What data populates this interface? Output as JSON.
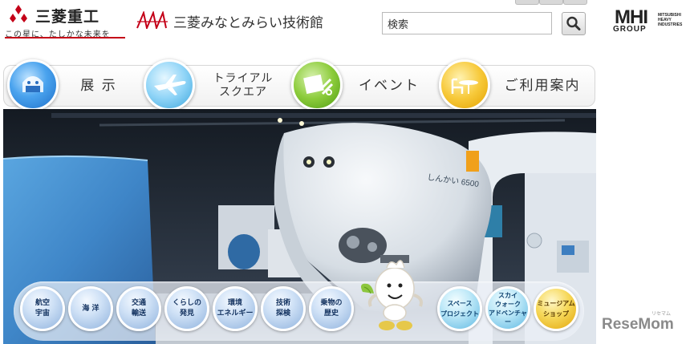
{
  "header": {
    "brand_name": "三菱重工",
    "brand_tagline": "この星に、たしかな未来を",
    "museum_name": "三菱みなとみらい技術館",
    "search": {
      "value": "検索"
    },
    "mhi_logo": {
      "letters": "MHI",
      "group": "GROUP",
      "subtext": "MITSUBISHI HEAVY INDUSTRIES"
    }
  },
  "nav": {
    "items": [
      {
        "label": "展 示",
        "icon": "exhibit-icon"
      },
      {
        "label": "トライアル\nスクエア",
        "icon": "airplane-icon"
      },
      {
        "label": "イベント",
        "icon": "event-icon"
      },
      {
        "label": "ご利用案内",
        "icon": "guide-icon"
      }
    ]
  },
  "subnav": {
    "items": [
      {
        "label": "航空\n宇宙"
      },
      {
        "label": "海 洋"
      },
      {
        "label": "交通\n輸送"
      },
      {
        "label": "くらしの\n発見"
      },
      {
        "label": "環境\nエネルギー"
      },
      {
        "label": "技術\n探検"
      },
      {
        "label": "乗物の\n歴史"
      },
      {
        "label": "スペース\nプロジェクト"
      },
      {
        "label": "スカイ\nウォーク\nアドベンチャー"
      },
      {
        "label": "ミュージアム\nショップ"
      }
    ]
  },
  "hero": {
    "submarine_label": "しんかい 6500"
  },
  "watermark": {
    "text": "ReseMom",
    "ruby": "リセマム"
  },
  "colors": {
    "brand_red": "#c40018",
    "nav_text": "#333333"
  }
}
